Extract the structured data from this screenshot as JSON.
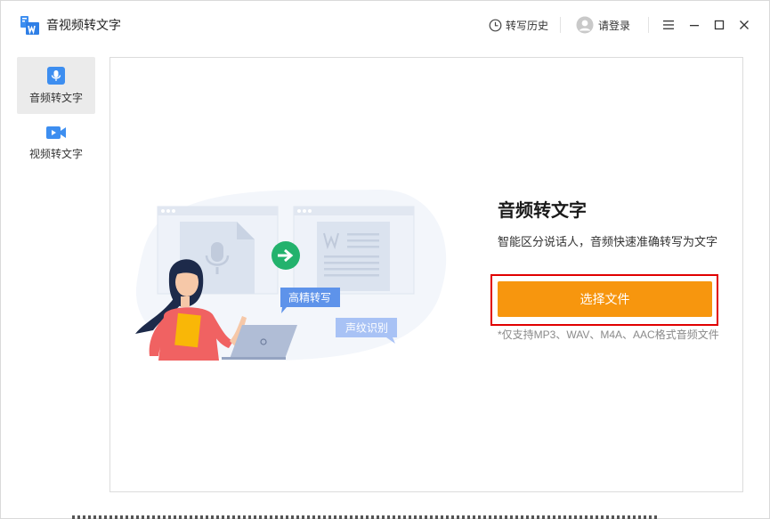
{
  "app": {
    "title": "音视频转文字"
  },
  "header": {
    "history_label": "转写历史",
    "login_label": "请登录"
  },
  "sidebar": {
    "items": [
      {
        "label": "音频转文字",
        "icon": "microphone-icon",
        "active": true
      },
      {
        "label": "视频转文字",
        "icon": "video-camera-icon",
        "active": false
      }
    ]
  },
  "main": {
    "feature_title": "音频转文字",
    "feature_desc": "智能区分说话人，音频快速准确转写为文字",
    "choose_button": "选择文件",
    "support_note": "*仅支持MP3、WAV、M4A、AAC格式音频文件",
    "illustration": {
      "bubble_1": "高精转写",
      "bubble_2": "声纹识别"
    }
  },
  "colors": {
    "accent": "#f7960e",
    "brand_blue": "#3d8ef0",
    "highlight": "#e00000",
    "arrow_green": "#23b26d"
  }
}
